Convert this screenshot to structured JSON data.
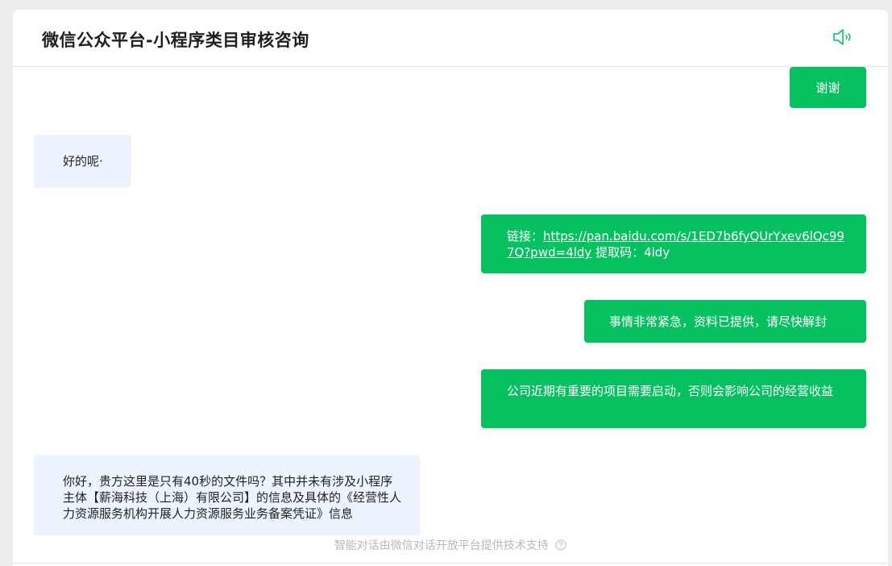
{
  "header": {
    "title": "微信公众平台-小程序类目审核咨询",
    "speaker_icon": "speaker-icon"
  },
  "messages": [
    {
      "role": "user",
      "text": "谢谢"
    },
    {
      "role": "bot",
      "text": "好的呢·"
    },
    {
      "role": "user",
      "prefix": "链接：",
      "link": "https://pan.baidu.com/s/1ED7b6fyQUrYxev6lQc997Q?pwd=4ldy",
      "suffix": " 提取码：4ldy"
    },
    {
      "role": "user",
      "text": "事情非常紧急，资料已提供，请尽快解封"
    },
    {
      "role": "user",
      "text": "公司近期有重要的项目需要启动，否则会影响公司的经营收益"
    },
    {
      "role": "bot",
      "text": "你好，贵方这里是只有40秒的文件吗？其中并未有涉及小程序主体【薪海科技（上海）有限公司】的信息及具体的《经营性人力资源服务机构开展人力资源服务业务备案凭证》信息"
    }
  ],
  "footer": {
    "text": "智能对话由微信对话开放平台提供技术支持",
    "help_icon": "help-icon"
  },
  "colors": {
    "accent": "#07c160",
    "bot_bubble": "#eef4ff",
    "background": "#ededed"
  }
}
